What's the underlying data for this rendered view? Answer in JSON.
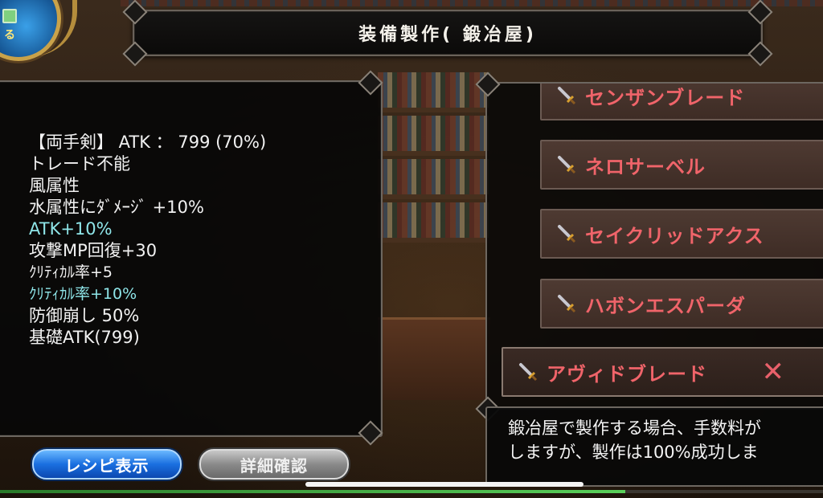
{
  "title": "装備製作(  鍛冶屋)",
  "medallion": {
    "label": "る",
    "icon": "square-icon"
  },
  "item_info": {
    "lines": [
      {
        "text": "【両手剣】  ATK  ：  799   (70%)",
        "color": "white"
      },
      {
        "text": "トレード不能",
        "color": "white"
      },
      {
        "text": "風属性",
        "color": "white"
      },
      {
        "text": "水属性にﾀﾞﾒｰｼﾞ +10%",
        "color": "white"
      },
      {
        "text": "ATK+10%",
        "color": "cyan"
      },
      {
        "text": "攻撃MP回復+30",
        "color": "white"
      },
      {
        "text": "ｸﾘﾃｨｶﾙ率+5",
        "color": "white"
      },
      {
        "text": "ｸﾘﾃｨｶﾙ率+10%",
        "color": "cyan"
      },
      {
        "text": "防御崩し 50%",
        "color": "white"
      },
      {
        "text": "基礎ATK(799)",
        "color": "white"
      }
    ]
  },
  "recipes": [
    {
      "name": "センザンブレード",
      "icon": "sword-icon",
      "selected": false
    },
    {
      "name": "ネロサーベル",
      "icon": "sword-icon",
      "selected": false
    },
    {
      "name": "セイクリッドアクス",
      "icon": "sword-icon",
      "selected": false
    },
    {
      "name": "ハボンエスパーダ",
      "icon": "sword-icon",
      "selected": false
    },
    {
      "name": "アヴィドブレード",
      "icon": "sword-icon",
      "selected": true
    }
  ],
  "close_label": "✕",
  "description": "鍛冶屋で製作する場合、手数料が\nしますが、製作は100%成功しま",
  "buttons": {
    "recipe": "レシピ表示",
    "detail": "詳細確認"
  },
  "progress": {
    "fraction": 0.76
  },
  "colors": {
    "recipe_text": "#f0646a",
    "cyan_text": "#8fe6e9",
    "recipe_button": "#1a6fe0"
  }
}
